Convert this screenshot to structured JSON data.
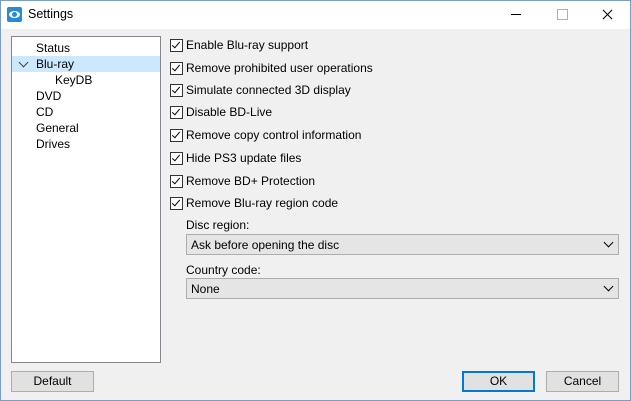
{
  "window": {
    "title": "Settings",
    "icon": "app-eye-icon"
  },
  "sidebar": {
    "items": [
      {
        "label": "Status",
        "selected": false,
        "expanded": null,
        "indent": 0
      },
      {
        "label": "Blu-ray",
        "selected": true,
        "expanded": true,
        "indent": 0
      },
      {
        "label": "KeyDB",
        "selected": false,
        "expanded": null,
        "indent": 1
      },
      {
        "label": "DVD",
        "selected": false,
        "expanded": null,
        "indent": 0
      },
      {
        "label": "CD",
        "selected": false,
        "expanded": null,
        "indent": 0
      },
      {
        "label": "General",
        "selected": false,
        "expanded": null,
        "indent": 0
      },
      {
        "label": "Drives",
        "selected": false,
        "expanded": null,
        "indent": 0
      }
    ]
  },
  "options": [
    {
      "label": "Enable Blu-ray support",
      "checked": true
    },
    {
      "label": "Remove prohibited user operations",
      "checked": true
    },
    {
      "label": "Simulate connected 3D display",
      "checked": true
    },
    {
      "label": "Disable BD-Live",
      "checked": true
    },
    {
      "label": "Remove copy control information",
      "checked": true
    },
    {
      "label": "Hide PS3 update files",
      "checked": true
    },
    {
      "label": "Remove BD+ Protection",
      "checked": true
    },
    {
      "label": "Remove Blu-ray region code",
      "checked": true
    }
  ],
  "disc_region": {
    "label": "Disc region:",
    "value": "Ask before opening the disc"
  },
  "country_code": {
    "label": "Country code:",
    "value": "None"
  },
  "buttons": {
    "default": "Default",
    "ok": "OK",
    "cancel": "Cancel"
  },
  "colors": {
    "selection": "#cce8ff",
    "accent": "#0078d7",
    "dialog_bg": "#f0f0f0"
  }
}
